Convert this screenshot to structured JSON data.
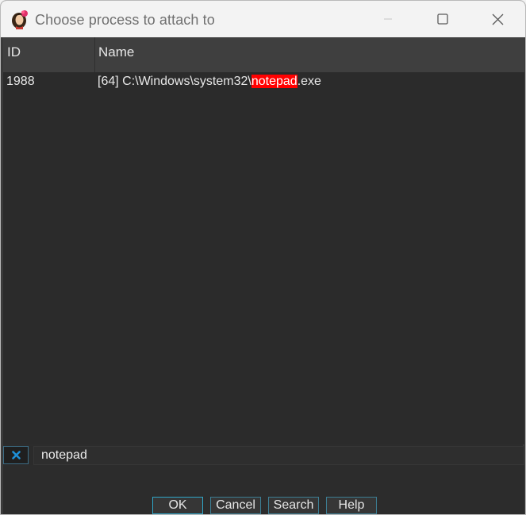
{
  "window": {
    "title": "Choose process to attach to"
  },
  "table": {
    "columns": [
      "ID",
      "Name"
    ],
    "rows": [
      {
        "id": "1988",
        "name_prefix": "[64] C:\\Windows\\system32\\",
        "name_match": "notepad",
        "name_suffix": ".exe"
      }
    ]
  },
  "filter": {
    "value": "notepad",
    "clear_icon": "close-x-icon"
  },
  "buttons": {
    "ok": "OK",
    "cancel": "Cancel",
    "search": "Search",
    "help": "Help"
  },
  "colors": {
    "highlight": "#ff0000",
    "accent": "#2fa6c8",
    "clear_icon": "#1e8fd6"
  }
}
